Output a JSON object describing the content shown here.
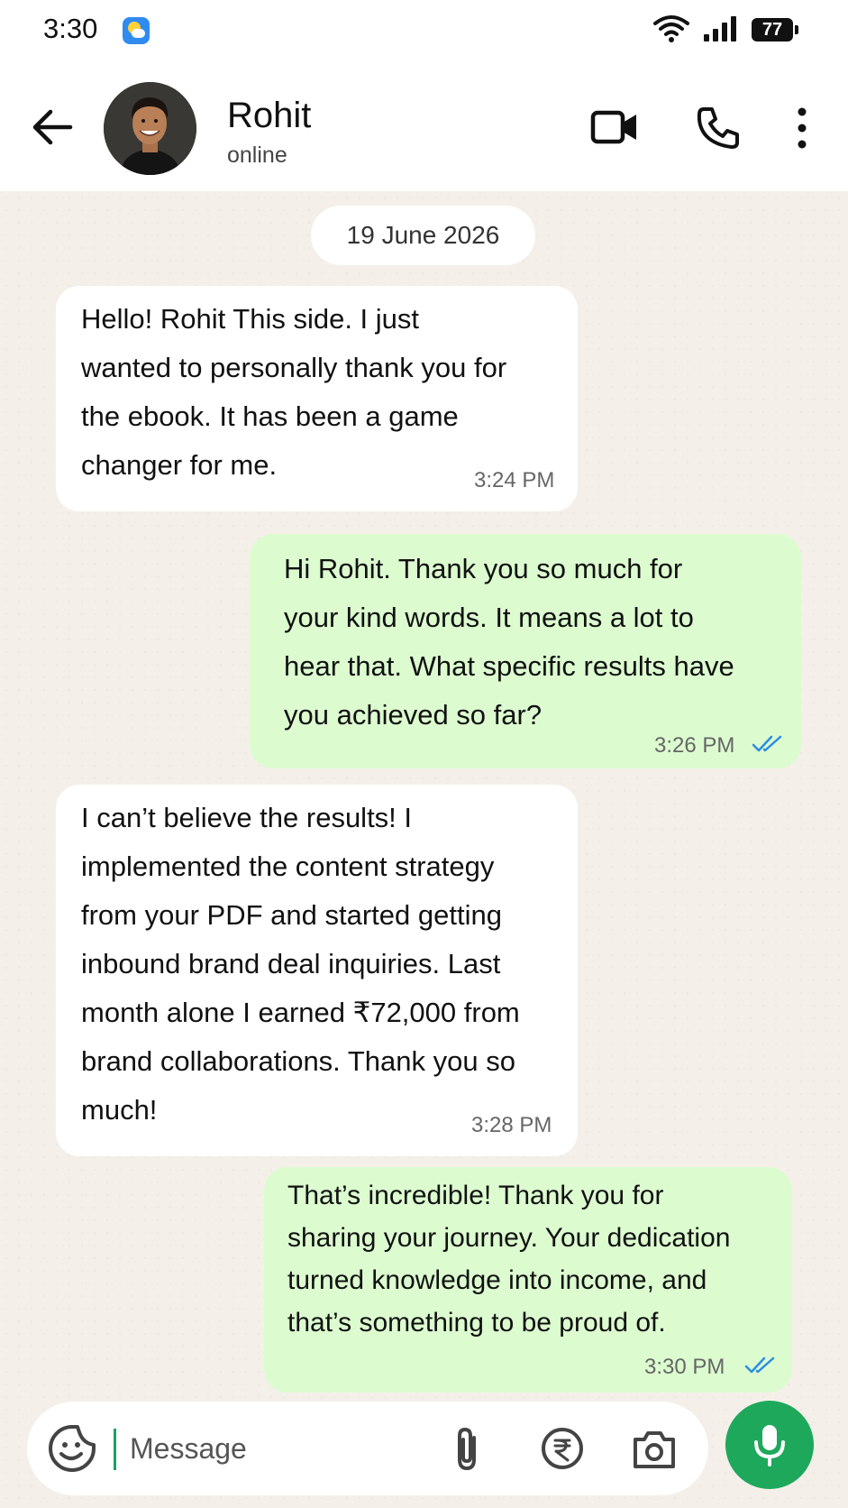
{
  "status_bar": {
    "time": "3:30",
    "battery": "77"
  },
  "header": {
    "contact_name": "Rohit",
    "contact_status": "online"
  },
  "chat": {
    "date_chip": "19 June 2026",
    "messages": [
      {
        "direction": "incoming",
        "text": "Hello! Rohit This side. I just\nwanted to personally thank you for\nthe ebook. It has been a game\nchanger for me.",
        "time": "3:24 PM"
      },
      {
        "direction": "outgoing",
        "text": "Hi Rohit. Thank you so much for\nyour kind words. It means a lot to\nhear that. What specific results have\nyou achieved so far?",
        "time": "3:26 PM",
        "status": "read"
      },
      {
        "direction": "incoming",
        "text": "I can’t believe the results! I\nimplemented the content strategy\nfrom your PDF and started getting\ninbound brand deal inquiries. Last\nmonth alone I earned ₹72,000 from\nbrand collaborations. Thank you so\nmuch!",
        "time": "3:28 PM"
      },
      {
        "direction": "outgoing",
        "text": "That’s incredible! Thank you for\nsharing your journey. Your dedication\nturned knowledge into income, and\nthat’s something to be proud of.",
        "time": "3:30 PM",
        "status": "read"
      }
    ]
  },
  "input": {
    "placeholder": "Message"
  },
  "colors": {
    "outgoing_bubble": "#dcfcd0",
    "incoming_bubble": "#ffffff",
    "chat_background": "#f4f0e9",
    "accent_green": "#1ea85c",
    "read_tick_blue": "#2a8de0"
  }
}
